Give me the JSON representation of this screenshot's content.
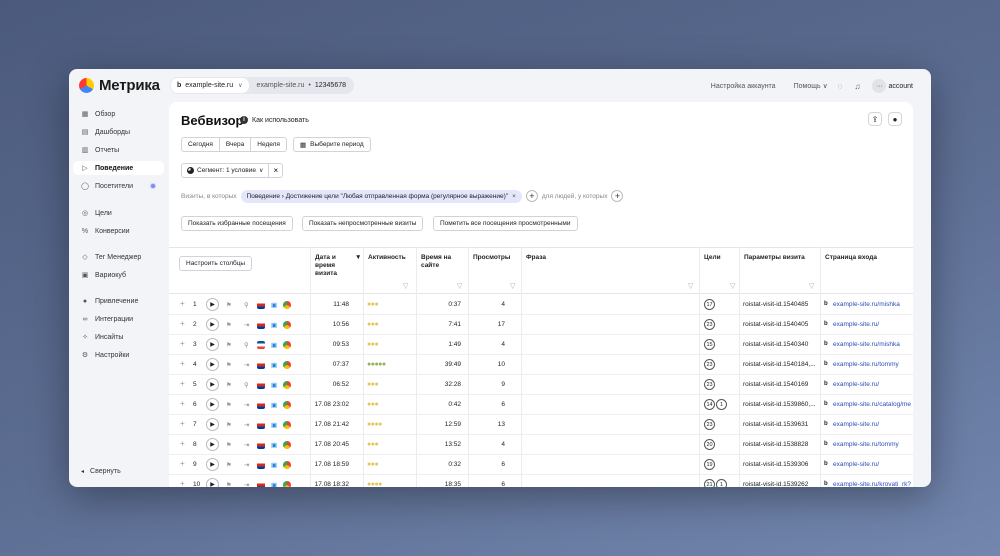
{
  "app": {
    "logo_text": "Метрика",
    "site_name": "example-site.ru",
    "site_alt": "example-site.ru",
    "site_sep": "•",
    "counter_id": "12345678",
    "account_settings": "Настройка аккаунта",
    "help": "Помощь",
    "account": "account"
  },
  "sidebar": {
    "items": [
      {
        "label": "Обзор",
        "icon": "grid-icon",
        "glyph": "▦"
      },
      {
        "label": "Дашборды",
        "icon": "dashboard-icon",
        "glyph": "▤"
      },
      {
        "label": "Отчеты",
        "icon": "reports-icon",
        "glyph": "▥"
      },
      {
        "label": "Поведение",
        "icon": "play-icon",
        "glyph": "▷"
      },
      {
        "label": "Посетители",
        "icon": "user-icon",
        "glyph": "◯"
      },
      {
        "label": "Цели",
        "icon": "target-icon",
        "glyph": "◎"
      },
      {
        "label": "Конверсии",
        "icon": "percent-icon",
        "glyph": "%"
      },
      {
        "label": "Тег Менеджер",
        "icon": "tag-icon",
        "glyph": "◇"
      },
      {
        "label": "Вариокуб",
        "icon": "cube-icon",
        "glyph": "▣"
      },
      {
        "label": "Привлечение",
        "icon": "attraction-icon",
        "glyph": "●"
      },
      {
        "label": "Интеграции",
        "icon": "link-icon",
        "glyph": "∞"
      },
      {
        "label": "Инсайты",
        "icon": "insight-icon",
        "glyph": "✧"
      },
      {
        "label": "Настройки",
        "icon": "gear-icon",
        "glyph": "⚙"
      }
    ],
    "collapse": "Свернуть"
  },
  "page": {
    "title": "Вебвизор",
    "howto": "Как использовать"
  },
  "periods": [
    "Сегодня",
    "Вчера",
    "Неделя"
  ],
  "choose_period": "Выберите период",
  "segment": "Сегмент: 1 условие",
  "filters": {
    "prefix": "Визиты, в которых",
    "chip": "Поведение › Достижение цели \"Любая отправленная форма (регулярное выражение)\"",
    "people": "для людей, у которых"
  },
  "actions": {
    "favorites": "Показать избранные посещения",
    "unviewed": "Показать непросмотренные визиты",
    "mark_all": "Пометить все посещения просмотренными"
  },
  "table": {
    "configure": "Настроить столбцы",
    "headers": {
      "date": "Дата и время визита",
      "activity": "Активность",
      "time": "Время на сайте",
      "views": "Просмотры",
      "phrase": "Фраза",
      "goals": "Цели",
      "params": "Параметры визита",
      "entry": "Страница входа"
    },
    "rows": [
      {
        "n": "1",
        "date": "11:48",
        "activity": "●●●",
        "act_class": "",
        "time": "0:37",
        "views": "4",
        "goals": "17",
        "goals2": "",
        "params": "roistat-visit-id.1540485",
        "entry": "example-site.ru/mishka"
      },
      {
        "n": "2",
        "date": "10:56",
        "activity": "●●●",
        "act_class": "",
        "time": "7:41",
        "views": "17",
        "goals": "23",
        "goals2": "",
        "params": "roistat-visit-id.1540405",
        "entry": "example-site.ru/"
      },
      {
        "n": "3",
        "date": "09:53",
        "activity": "●●●",
        "act_class": "",
        "time": "1:49",
        "views": "4",
        "goals": "15",
        "goals2": "",
        "params": "roistat-visit-id.1540340",
        "entry": "example-site.ru/mishka"
      },
      {
        "n": "4",
        "date": "07:37",
        "activity": "●●●●●",
        "act_class": "g",
        "time": "39:49",
        "views": "10",
        "goals": "23",
        "goals2": "",
        "params": "roistat-visit-id.1540184,...",
        "entry": "example-site.ru/tommy"
      },
      {
        "n": "5",
        "date": "06:52",
        "activity": "●●●",
        "act_class": "",
        "time": "32:28",
        "views": "9",
        "goals": "23",
        "goals2": "",
        "params": "roistat-visit-id.1540169",
        "entry": "example-site.ru/"
      },
      {
        "n": "6",
        "date": "17.08 23:02",
        "activity": "●●●",
        "act_class": "",
        "time": "0:42",
        "views": "6",
        "goals": "14",
        "goals2": "1",
        "params": "roistat-visit-id.1539860,...",
        "entry": "example-site.ru/catalog/me"
      },
      {
        "n": "7",
        "date": "17.08 21:42",
        "activity": "●●●●",
        "act_class": "",
        "time": "12:59",
        "views": "13",
        "goals": "23",
        "goals2": "",
        "params": "roistat-visit-id.1539631",
        "entry": "example-site.ru/"
      },
      {
        "n": "8",
        "date": "17.08 20:45",
        "activity": "●●●",
        "act_class": "",
        "time": "13:52",
        "views": "4",
        "goals": "20",
        "goals2": "",
        "params": "roistat-visit-id.1538828",
        "entry": "example-site.ru/tommy"
      },
      {
        "n": "9",
        "date": "17.08 18:59",
        "activity": "●●●",
        "act_class": "",
        "time": "0:32",
        "views": "6",
        "goals": "19",
        "goals2": "",
        "params": "roistat-visit-id.1539306",
        "entry": "example-site.ru/"
      },
      {
        "n": "10",
        "date": "17.08 18:32",
        "activity": "●●●●",
        "act_class": "",
        "time": "18:35",
        "views": "6",
        "goals": "21",
        "goals2": "1",
        "params": "roistat-visit-id.1539262",
        "entry": "example-site.ru/krovati_rk?"
      }
    ],
    "source_icons": [
      "search",
      "login",
      "search",
      "login",
      "search",
      "login",
      "login",
      "login",
      "login",
      "login"
    ],
    "flag_colors": [
      [
        "#ffffff",
        "#d52b1e",
        "#0039a6"
      ],
      [
        "#ffffff",
        "#d52b1e",
        "#0039a6"
      ],
      [
        "#0055a4",
        "#ffffff",
        "#ef4135"
      ],
      [
        "#ffffff",
        "#d52b1e",
        "#0039a6"
      ],
      [
        "#ffffff",
        "#d52b1e",
        "#0039a6"
      ],
      [
        "#ffffff",
        "#d52b1e",
        "#0039a6"
      ],
      [
        "#ffffff",
        "#d52b1e",
        "#0039a6"
      ],
      [
        "#ffffff",
        "#d52b1e",
        "#0039a6"
      ],
      [
        "#ffffff",
        "#d52b1e",
        "#0039a6"
      ],
      [
        "#ffffff",
        "#d52b1e",
        "#0039a6"
      ]
    ]
  }
}
